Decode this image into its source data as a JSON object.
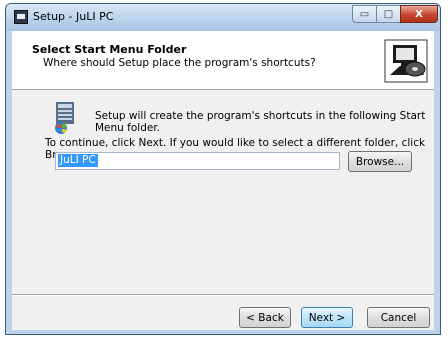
{
  "window": {
    "title": "Setup - JuLI PC",
    "minimize_symbol": "▭",
    "maximize_symbol": "□",
    "close_symbol": "X"
  },
  "header": {
    "title": "Select Start Menu Folder",
    "subtitle": "Where should Setup place the program's shortcuts?"
  },
  "body": {
    "info_text": "Setup will create the program's shortcuts in the following Start Menu folder.",
    "instruction_text": "To continue, click Next. If you would like to select a different folder, click Browse.",
    "folder_value": "JuLI PC",
    "browse_label": "Browse..."
  },
  "footer": {
    "back_label": "< Back",
    "next_label": "Next >",
    "cancel_label": "Cancel"
  },
  "icons": {
    "app": "setup-app-icon",
    "header": "computer-disc-icon",
    "folder": "start-menu-folder-icon"
  },
  "colors": {
    "selection": "#3399ff",
    "close_button": "#c7452d",
    "default_button_border": "#3c7fb1"
  }
}
